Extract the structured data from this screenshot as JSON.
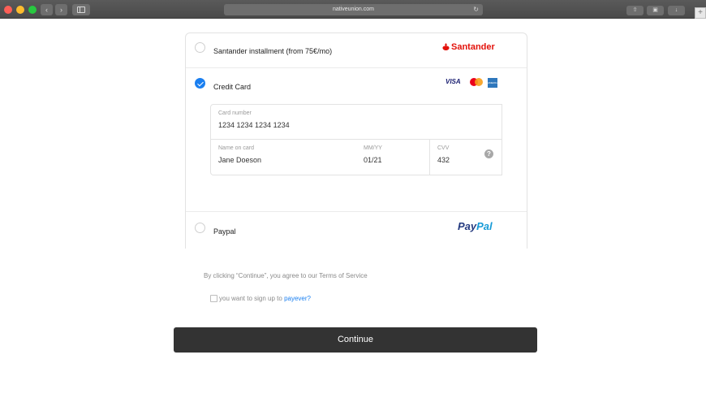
{
  "browser": {
    "url": "nativeunion.com",
    "new_tab_symbol": "+"
  },
  "payment": {
    "santander": {
      "label": "Santander installment (from 75€/mo)",
      "logo_text": "Santander",
      "brand_color": "#e3120b",
      "selected": false
    },
    "credit_card": {
      "label": "Credit Card",
      "selected": true,
      "accent_color": "#1a7ff0",
      "card_brands": {
        "visa": "VISA",
        "mastercard": "mastercard-icon",
        "amex": "AMERICAN EXPRESS"
      },
      "card_number": {
        "caption": "Card number",
        "value": "1234 1234 1234 1234"
      },
      "name_on_card": {
        "caption": "Name on card",
        "value": "Jane Doeson"
      },
      "expiry": {
        "caption": "MM/YY",
        "value": "01/21"
      },
      "cvv": {
        "caption": "CVV",
        "value": "432",
        "help_symbol": "?"
      }
    },
    "paypal": {
      "label": "Paypal",
      "logo_part1": "Pay",
      "logo_part2": "Pal",
      "selected": false
    }
  },
  "terms_text": "By clicking “Continue”, you agree to our Terms of Service",
  "signup": {
    "text": "you want to sign up to ",
    "link": "payever?"
  },
  "continue_label": "Continue"
}
